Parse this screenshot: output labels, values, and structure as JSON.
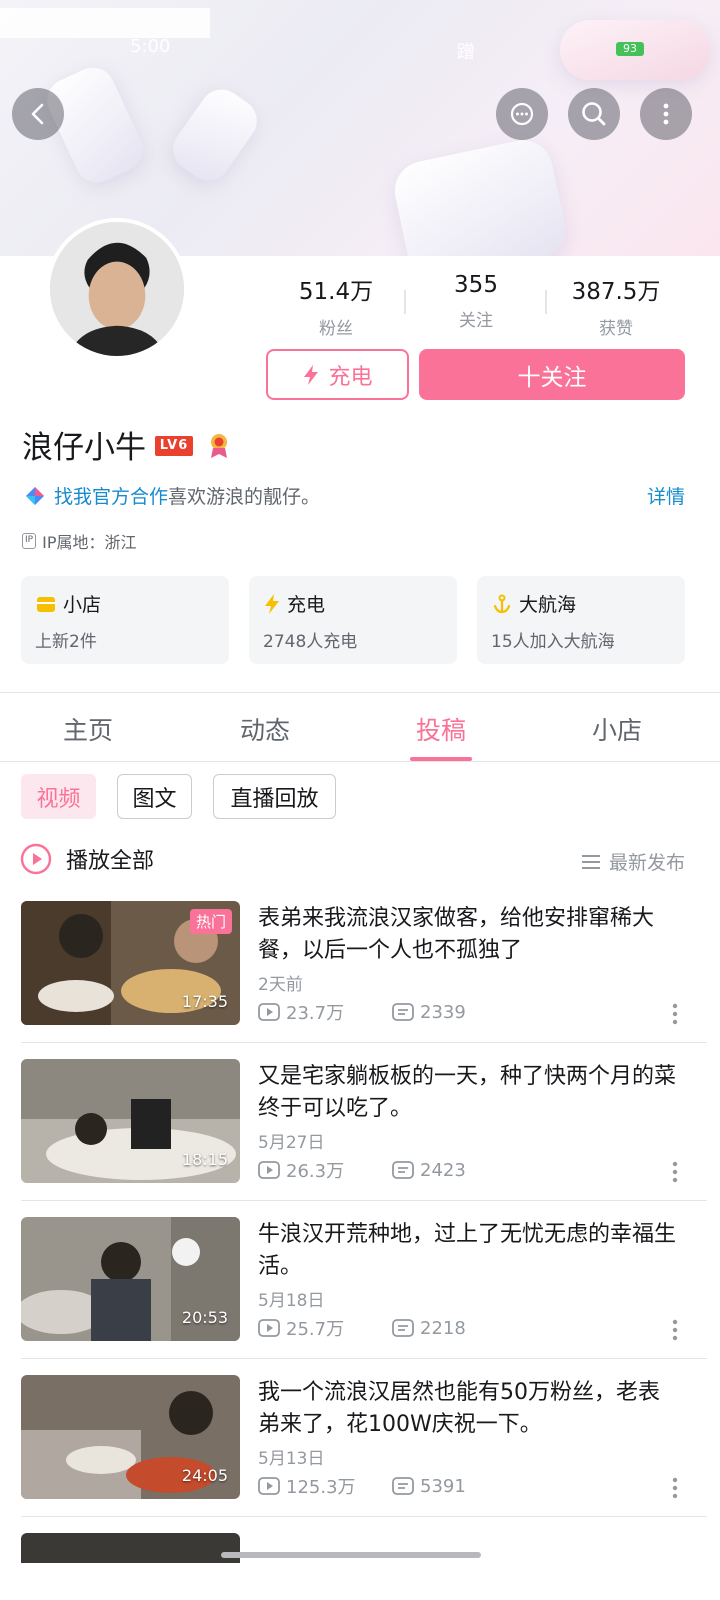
{
  "status_bar": {
    "time": "5:00",
    "right_text": "蹭",
    "battery": "93"
  },
  "stats": [
    {
      "value": "51.4万",
      "label": "粉丝"
    },
    {
      "value": "355",
      "label": "关注"
    },
    {
      "value": "387.5万",
      "label": "获赞"
    }
  ],
  "buttons": {
    "charge": "充电",
    "follow": "十关注"
  },
  "profile": {
    "name": "浪仔小牛",
    "level": "LV6",
    "bio_link": "找我官方合作",
    "bio_text": "喜欢游浪的靓仔。",
    "detail": "详情",
    "ip_tag": "IP",
    "ip": "IP属地：浙江"
  },
  "cards": [
    {
      "title": "小店",
      "sub": "上新2件",
      "icon": "shop-icon",
      "color": "#f6c000"
    },
    {
      "title": "充电",
      "sub": "2748人充电",
      "icon": "lightning-icon",
      "color": "#f6c000"
    },
    {
      "title": "大航海",
      "sub": "15人加入大航海",
      "icon": "anchor-icon",
      "color": "#f6c000"
    }
  ],
  "tabs": [
    "主页",
    "动态",
    "投稿",
    "小店"
  ],
  "active_tab": "投稿",
  "chips": [
    "视频",
    "图文",
    "直播回放"
  ],
  "list_header": {
    "play_all": "播放全部",
    "sort": "最新发布"
  },
  "videos": [
    {
      "title": "表弟来我流浪汉家做客，给他安排窜稀大餐，以后一个人也不孤独了",
      "date": "2天前",
      "views": "23.7万",
      "comments": "2339",
      "duration": "17:35",
      "badge": "热门"
    },
    {
      "title": "又是宅家躺板板的一天，种了快两个月的菜终于可以吃了。",
      "date": "5月27日",
      "views": "26.3万",
      "comments": "2423",
      "duration": "18:15",
      "badge": ""
    },
    {
      "title": "牛浪汉开荒种地，过上了无忧无虑的幸福生活。",
      "date": "5月18日",
      "views": "25.7万",
      "comments": "2218",
      "duration": "20:53",
      "badge": ""
    },
    {
      "title": "我一个流浪汉居然也能有50万粉丝，老表弟来了，花100W庆祝一下。",
      "date": "5月13日",
      "views": "125.3万",
      "comments": "5391",
      "duration": "24:05",
      "badge": ""
    }
  ],
  "colors": {
    "accent": "#fb7299",
    "link": "#178bcf",
    "level": "#e9412e"
  }
}
